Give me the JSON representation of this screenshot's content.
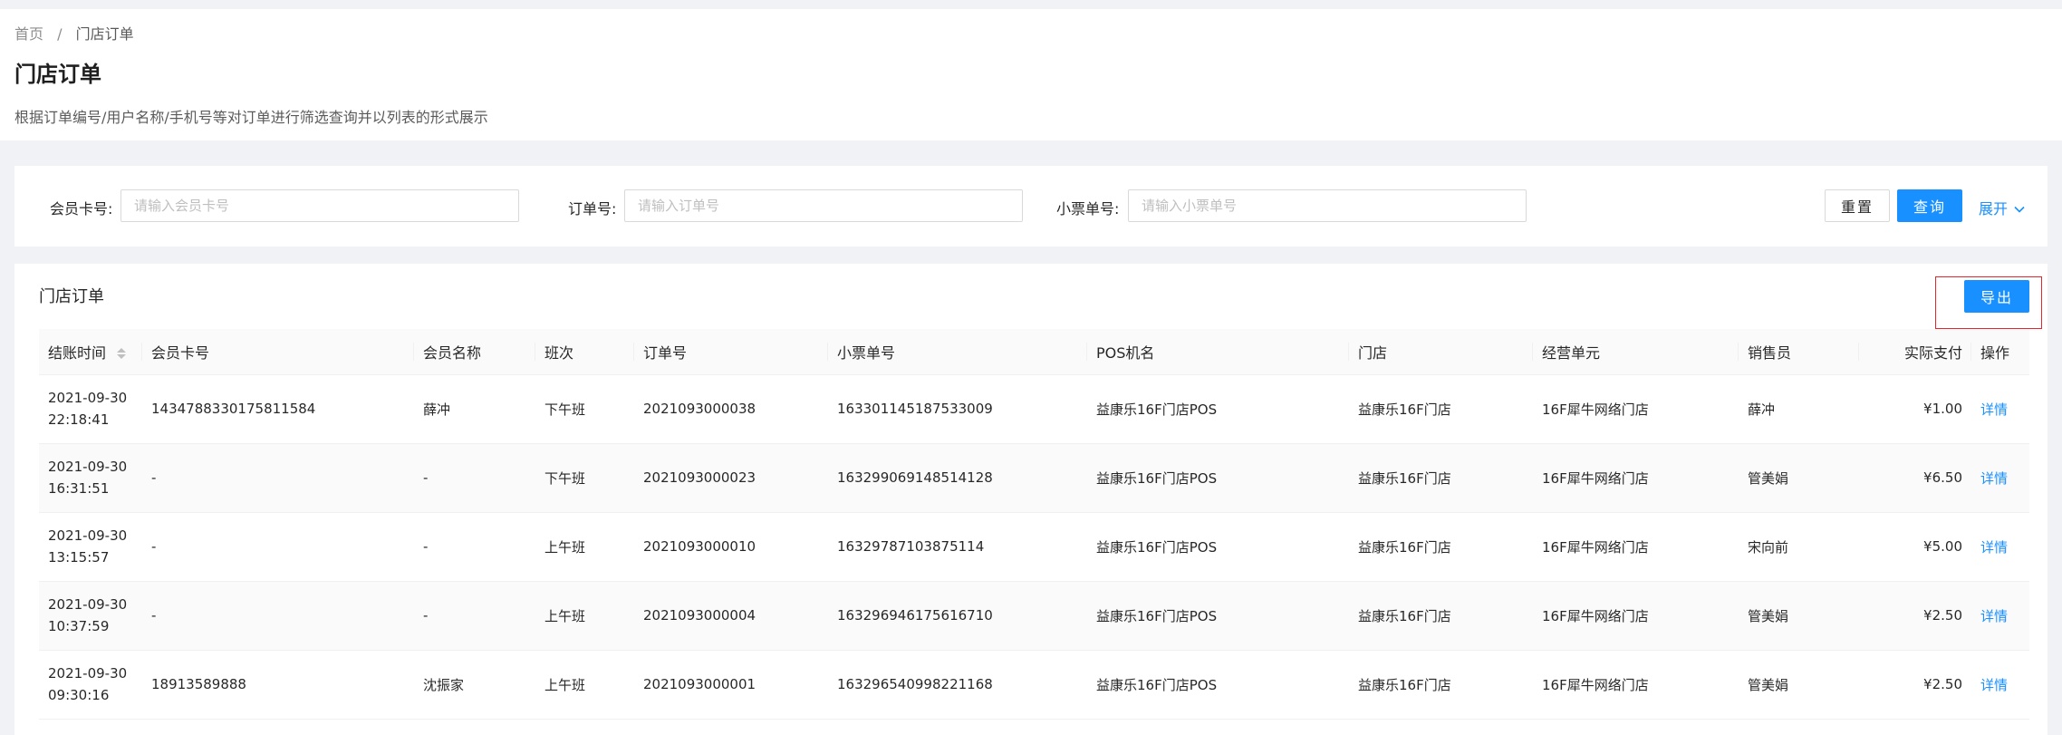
{
  "breadcrumb": {
    "home": "首页",
    "separator": "/",
    "current": "门店订单"
  },
  "page": {
    "title": "门店订单",
    "description": "根据订单编号/用户名称/手机号等对订单进行筛选查询并以列表的形式展示"
  },
  "search": {
    "member_card_label": "会员卡号:",
    "member_card_placeholder": "请输入会员卡号",
    "order_no_label": "订单号:",
    "order_no_placeholder": "请输入订单号",
    "receipt_no_label": "小票单号:",
    "receipt_no_placeholder": "请输入小票单号",
    "reset_label": "重置",
    "query_label": "查询",
    "expand_label": "展开"
  },
  "table": {
    "title": "门店订单",
    "export_label": "导出",
    "columns": {
      "checkout_time": "结账时间",
      "member_card": "会员卡号",
      "member_name": "会员名称",
      "shift": "班次",
      "order_no": "订单号",
      "receipt_no": "小票单号",
      "pos_name": "POS机名",
      "store": "门店",
      "business_unit": "经营单元",
      "salesperson": "销售员",
      "actual_paid": "实际支付",
      "action": "操作"
    },
    "rows": [
      {
        "date": "2021-09-30",
        "time": "22:18:41",
        "member_card": "1434788330175811584",
        "member_name": "薛冲",
        "shift": "下午班",
        "order_no": "2021093000038",
        "receipt_no": "163301145187533009",
        "pos_name": "益康乐16F门店POS",
        "store": "益康乐16F门店",
        "business_unit": "16F犀牛网络门店",
        "salesperson": "薛冲",
        "actual_paid": "¥1.00",
        "action": "详情"
      },
      {
        "date": "2021-09-30",
        "time": "16:31:51",
        "member_card": "-",
        "member_name": "-",
        "shift": "下午班",
        "order_no": "2021093000023",
        "receipt_no": "163299069148514128",
        "pos_name": "益康乐16F门店POS",
        "store": "益康乐16F门店",
        "business_unit": "16F犀牛网络门店",
        "salesperson": "管美娟",
        "actual_paid": "¥6.50",
        "action": "详情"
      },
      {
        "date": "2021-09-30",
        "time": "13:15:57",
        "member_card": "-",
        "member_name": "-",
        "shift": "上午班",
        "order_no": "2021093000010",
        "receipt_no": "16329787103875114",
        "pos_name": "益康乐16F门店POS",
        "store": "益康乐16F门店",
        "business_unit": "16F犀牛网络门店",
        "salesperson": "宋向前",
        "actual_paid": "¥5.00",
        "action": "详情"
      },
      {
        "date": "2021-09-30",
        "time": "10:37:59",
        "member_card": "-",
        "member_name": "-",
        "shift": "上午班",
        "order_no": "2021093000004",
        "receipt_no": "163296946175616710",
        "pos_name": "益康乐16F门店POS",
        "store": "益康乐16F门店",
        "business_unit": "16F犀牛网络门店",
        "salesperson": "管美娟",
        "actual_paid": "¥2.50",
        "action": "详情"
      },
      {
        "date": "2021-09-30",
        "time": "09:30:16",
        "member_card": "18913589888",
        "member_name": "沈振家",
        "shift": "上午班",
        "order_no": "2021093000001",
        "receipt_no": "163296540998221168",
        "pos_name": "益康乐16F门店POS",
        "store": "益康乐16F门店",
        "business_unit": "16F犀牛网络门店",
        "salesperson": "管美娟",
        "actual_paid": "¥2.50",
        "action": "详情"
      }
    ]
  },
  "colors": {
    "primary": "#1890ff",
    "highlight_border": "#e8242c",
    "page_bg": "#f0f2f5"
  },
  "icons": {
    "expand": "chevron-down-icon",
    "sort": "sort-caret-icon"
  }
}
